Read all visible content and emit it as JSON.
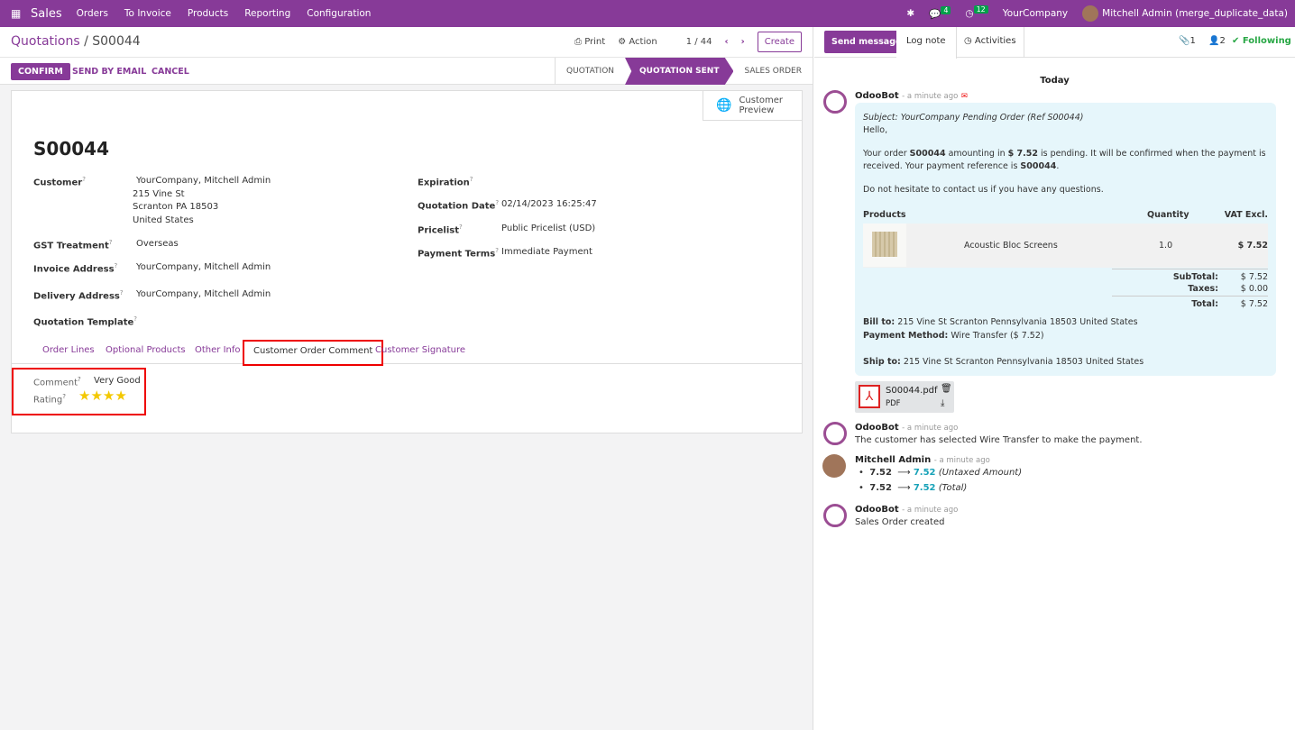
{
  "topbar": {
    "app": "Sales",
    "menu": [
      "Orders",
      "To Invoice",
      "Products",
      "Reporting",
      "Configuration"
    ],
    "messages_count": "4",
    "activities_count": "12",
    "company": "YourCompany",
    "user": "Mitchell Admin (merge_duplicate_data)"
  },
  "control": {
    "breadcrumb_parent": "Quotations",
    "breadcrumb_sep": "/",
    "breadcrumb_current": "S00044",
    "print": "Print",
    "action": "Action",
    "pager": "1 / 44",
    "create": "Create"
  },
  "statusbar": {
    "confirm": "CONFIRM",
    "send_email": "SEND BY EMAIL",
    "cancel": "CANCEL",
    "stages": [
      "QUOTATION",
      "QUOTATION SENT",
      "SALES ORDER"
    ]
  },
  "form": {
    "customer_preview": "Customer Preview",
    "name": "S00044",
    "customer_label": "Customer",
    "customer": "YourCompany, Mitchell Admin",
    "address1": "215 Vine St",
    "address2": "Scranton PA 18503",
    "address3": "United States",
    "gst_label": "GST Treatment",
    "gst": "Overseas",
    "invoice_label": "Invoice Address",
    "invoice": "YourCompany, Mitchell Admin",
    "delivery_label": "Delivery Address",
    "delivery": "YourCompany, Mitchell Admin",
    "template_label": "Quotation Template",
    "expiration_label": "Expiration",
    "qdate_label": "Quotation Date",
    "qdate": "02/14/2023 16:25:47",
    "pricelist_label": "Pricelist",
    "pricelist": "Public Pricelist (USD)",
    "terms_label": "Payment Terms",
    "terms": "Immediate Payment",
    "tabs": [
      "Order Lines",
      "Optional Products",
      "Other Info",
      "Customer Order Comment",
      "Customer Signature"
    ],
    "comment_label": "Comment",
    "comment": "Very Good",
    "rating_label": "Rating",
    "rating": 4
  },
  "chatter": {
    "send_message": "Send message",
    "log_note": "Log note",
    "activities": "Activities",
    "attachments": "1",
    "followers": "2",
    "following": "Following",
    "today": "Today",
    "m1": {
      "author": "OdooBot",
      "time": "- a minute ago",
      "subject": "Subject: YourCompany Pending Order (Ref S00044)",
      "hello": "Hello,",
      "p1a": "Your order ",
      "p1b": "S00044",
      "p1c": " amounting in ",
      "p1d": "$ 7.52",
      "p1e": " is pending. It will be confirmed when the payment is received. Your payment reference is ",
      "p1f": "S00044",
      "p1g": ".",
      "p2": "Do not hesitate to contact us if you have any questions.",
      "h_products": "Products",
      "h_qty": "Quantity",
      "h_vat": "VAT Excl.",
      "product": "Acoustic Bloc Screens",
      "qty": "1.0",
      "price": "$ 7.52",
      "subtotal_label": "SubTotal:",
      "subtotal": "$ 7.52",
      "taxes_label": "Taxes:",
      "taxes": "$ 0.00",
      "total_label": "Total:",
      "total": "$ 7.52",
      "bill_label": "Bill to:",
      "bill": "215 Vine St Scranton Pennsylvania 18503 United States",
      "pay_label": "Payment Method:",
      "pay": "Wire Transfer ($ 7.52)",
      "ship_label": "Ship to:",
      "ship": "215 Vine St Scranton Pennsylvania 18503 United States",
      "file": "S00044.pdf",
      "filetype": "PDF"
    },
    "m2": {
      "author": "OdooBot",
      "time": "- a minute ago",
      "text": "The customer has selected Wire Transfer to make the payment."
    },
    "m3": {
      "author": "Mitchell Admin",
      "time": "- a minute ago",
      "c1_old": "7.52",
      "c1_new": "7.52",
      "c1_field": "(Untaxed Amount)",
      "c2_old": "7.52",
      "c2_new": "7.52",
      "c2_field": "(Total)"
    },
    "m4": {
      "author": "OdooBot",
      "time": "- a minute ago",
      "text": "Sales Order created"
    }
  }
}
